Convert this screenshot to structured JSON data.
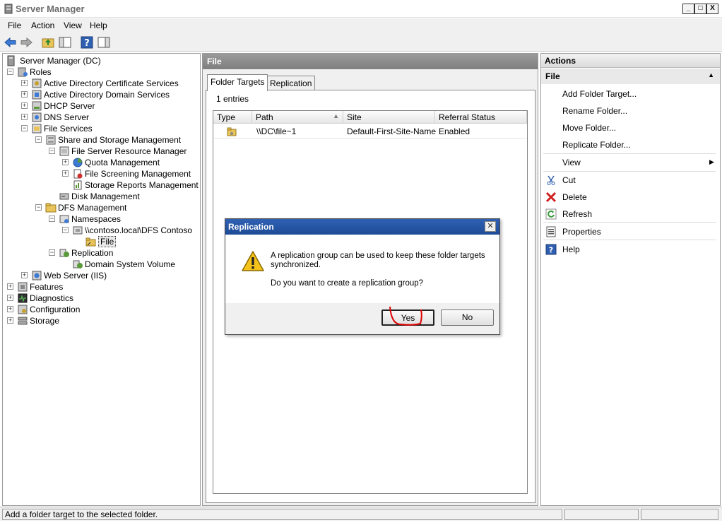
{
  "window": {
    "title": "Server Manager",
    "minimize_glyph": "_",
    "maximize_glyph": "□",
    "close_glyph": "X"
  },
  "menu": [
    "File",
    "Action",
    "View",
    "Help"
  ],
  "toolbar": [
    "back-icon",
    "forward-icon",
    "up-folder-icon",
    "show-hide-console-tree-icon",
    "help-icon",
    "show-hide-action-pane-icon"
  ],
  "tree": {
    "items": [
      {
        "label": "Server Manager (DC)",
        "exp": "",
        "icon": "server-manager-icon"
      },
      {
        "label": "Roles",
        "exp": "⊟",
        "icon": "roles-icon"
      },
      {
        "label": "Active Directory Certificate Services",
        "exp": "+",
        "icon": "adcs-icon"
      },
      {
        "label": "Active Directory Domain Services",
        "exp": "+",
        "icon": "adds-icon"
      },
      {
        "label": "DHCP Server",
        "exp": "+",
        "icon": "dhcp-icon"
      },
      {
        "label": "DNS Server",
        "exp": "+",
        "icon": "dns-icon"
      },
      {
        "label": "File Services",
        "exp": "−",
        "icon": "file-services-icon"
      },
      {
        "label": "Share and Storage Management",
        "exp": "−",
        "icon": "share-storage-icon"
      },
      {
        "label": "File Server Resource Manager",
        "exp": "−",
        "icon": "fsrm-icon"
      },
      {
        "label": "Quota Management",
        "exp": "+",
        "icon": "quota-icon"
      },
      {
        "label": "File Screening Management",
        "exp": "+",
        "icon": "file-screening-icon"
      },
      {
        "label": "Storage Reports Management",
        "exp": "",
        "icon": "storage-reports-icon"
      },
      {
        "label": "Disk Management",
        "exp": "",
        "icon": "disk-management-icon"
      },
      {
        "label": "DFS Management",
        "exp": "−",
        "icon": "dfs-management-icon"
      },
      {
        "label": "Namespaces",
        "exp": "−",
        "icon": "namespaces-icon"
      },
      {
        "label": "\\\\contoso.local\\DFS Contoso",
        "exp": "−",
        "icon": "namespace-icon"
      },
      {
        "label": "File",
        "exp": "",
        "icon": "folder-icon"
      },
      {
        "label": "Replication",
        "exp": "−",
        "icon": "replication-icon"
      },
      {
        "label": "Domain System Volume",
        "exp": "",
        "icon": "replication-group-icon"
      },
      {
        "label": "Web Server (IIS)",
        "exp": "+",
        "icon": "iis-icon"
      },
      {
        "label": "Features",
        "exp": "+",
        "icon": "features-icon"
      },
      {
        "label": "Diagnostics",
        "exp": "+",
        "icon": "diagnostics-icon"
      },
      {
        "label": "Configuration",
        "exp": "+",
        "icon": "configuration-icon"
      },
      {
        "label": "Storage",
        "exp": "+",
        "icon": "storage-icon"
      }
    ]
  },
  "center": {
    "header": "File",
    "tabs": [
      "Folder Targets",
      "Replication"
    ],
    "entries_text": "1 entries",
    "columns": [
      "Type",
      "Path",
      "Site",
      "Referral Status"
    ],
    "rows": [
      {
        "path": "\\\\DC\\file~1",
        "site": "Default-First-Site-Name",
        "status": "Enabled"
      }
    ]
  },
  "actions": {
    "header": "Actions",
    "section": "File",
    "items": [
      {
        "label": "Add Folder Target...",
        "icon": ""
      },
      {
        "label": "Rename Folder...",
        "icon": ""
      },
      {
        "label": "Move Folder...",
        "icon": ""
      },
      {
        "label": "Replicate Folder...",
        "icon": ""
      },
      {
        "label": "View",
        "icon": ""
      },
      {
        "label": "Cut",
        "icon": "cut-icon"
      },
      {
        "label": "Delete",
        "icon": "delete-icon"
      },
      {
        "label": "Refresh",
        "icon": "refresh-icon"
      },
      {
        "label": "Properties",
        "icon": "properties-icon"
      },
      {
        "label": "Help",
        "icon": "help-icon"
      }
    ]
  },
  "dialog": {
    "title": "Replication",
    "message_line1": "A replication group can be used to keep these folder targets",
    "message_line2": "synchronized.",
    "question": "Do you want to create a replication group?",
    "yes_label": "Yes",
    "no_label": "No",
    "icon": "warning-icon"
  },
  "statusbar": {
    "text": "Add a folder target to the selected folder."
  }
}
